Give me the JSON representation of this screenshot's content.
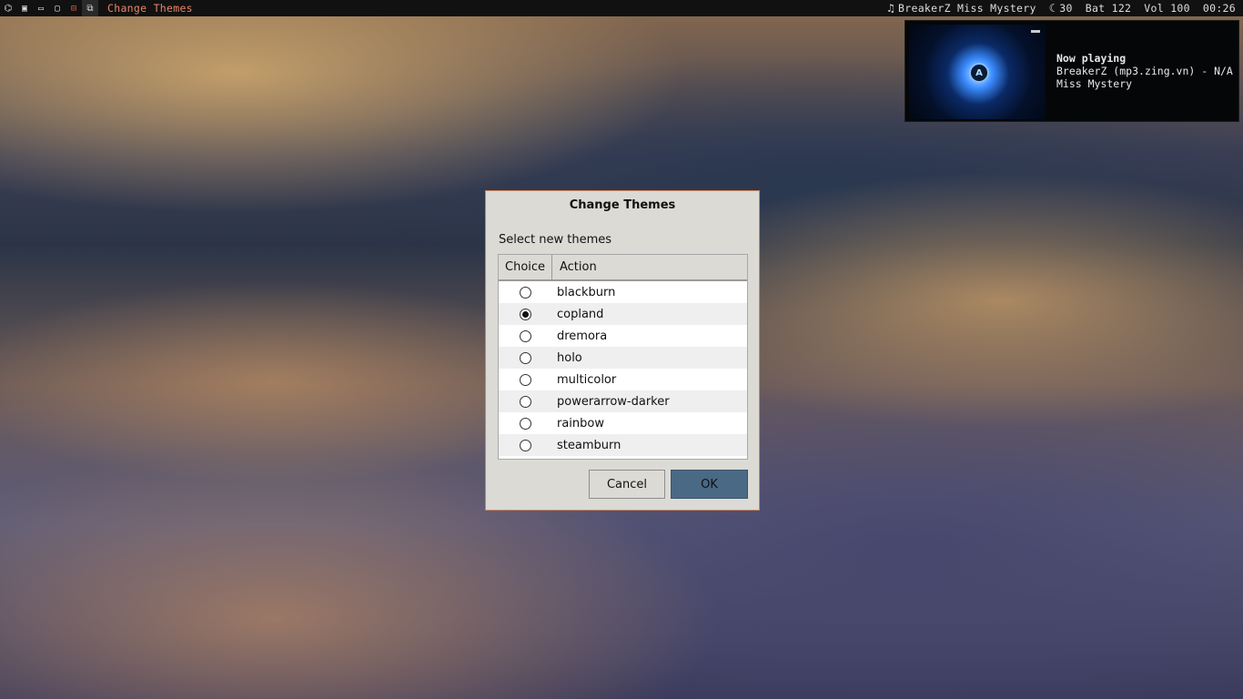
{
  "topbar": {
    "icons": [
      "terminal-icon",
      "window-icon",
      "tile-icon",
      "monitor-icon",
      "layout-icon",
      "float-icon"
    ],
    "window_title": "Change Themes",
    "now_playing": "BreakerZ Miss Mystery",
    "moon_value": "30",
    "battery": "Bat 122",
    "volume": "Vol 100",
    "clock": "00:26"
  },
  "notification": {
    "heading": "Now playing",
    "line1": "BreakerZ (mp3.zing.vn) - N/A",
    "line2": "Miss Mystery"
  },
  "dialog": {
    "title": "Change Themes",
    "prompt": "Select new themes",
    "columns": {
      "choice": "Choice",
      "action": "Action"
    },
    "options": [
      {
        "label": "blackburn",
        "selected": false
      },
      {
        "label": "copland",
        "selected": true
      },
      {
        "label": "dremora",
        "selected": false
      },
      {
        "label": "holo",
        "selected": false
      },
      {
        "label": "multicolor",
        "selected": false
      },
      {
        "label": "powerarrow-darker",
        "selected": false
      },
      {
        "label": "rainbow",
        "selected": false
      },
      {
        "label": "steamburn",
        "selected": false
      }
    ],
    "cancel_label": "Cancel",
    "ok_label": "OK"
  },
  "colors": {
    "accent": "#e8866a",
    "ok_button": "#4a6984",
    "dialog_bg": "#dcdad5"
  }
}
